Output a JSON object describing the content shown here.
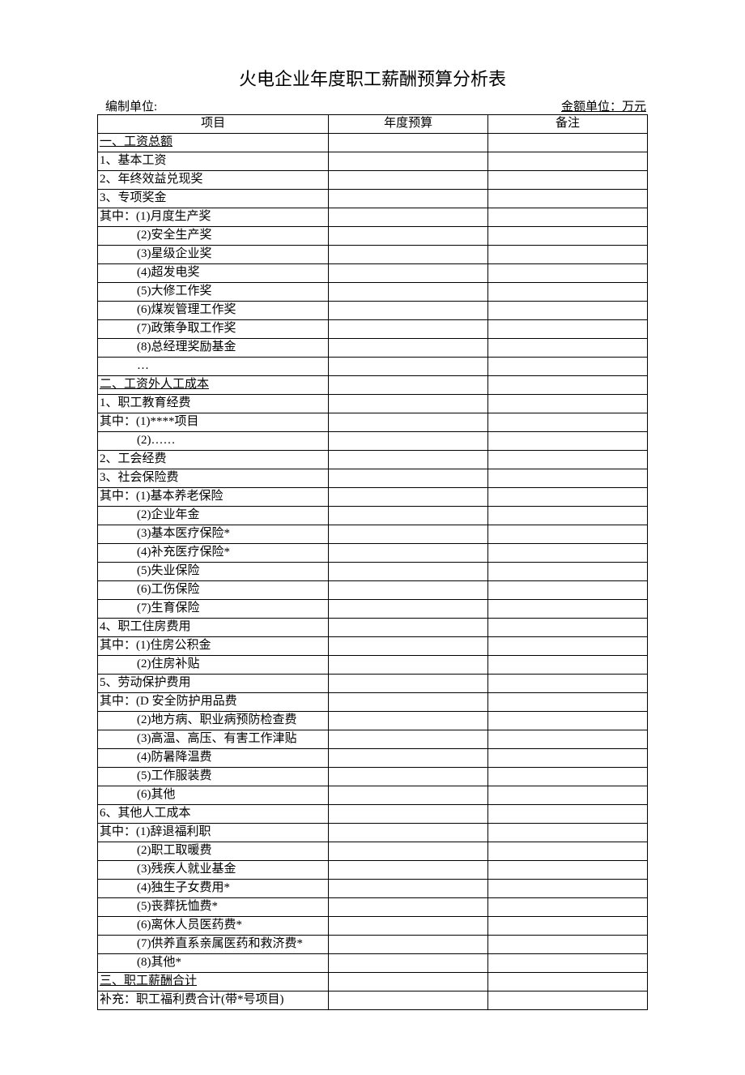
{
  "title": "火电企业年度职工薪酬预算分析表",
  "meta": {
    "left": "编制单位:",
    "right": "金额单位：万元"
  },
  "headers": {
    "c1": "项目",
    "c2": "年度预算",
    "c3": "备注"
  },
  "rows": [
    {
      "label": "一、工资总额",
      "class": "section-header"
    },
    {
      "label": "1、基本工资",
      "class": "indent0"
    },
    {
      "label": "2、年终效益兑现奖",
      "class": "indent0"
    },
    {
      "label": "3、专项奖金",
      "class": "indent0"
    },
    {
      "label": "其中：(1)月度生产奖",
      "class": "indent0"
    },
    {
      "label": "(2)安全生产奖",
      "class": "indent1"
    },
    {
      "label": "(3)星级企业奖",
      "class": "indent1"
    },
    {
      "label": "(4)超发电奖",
      "class": "indent1"
    },
    {
      "label": "(5)大修工作奖",
      "class": "indent1"
    },
    {
      "label": "(6)煤炭管理工作奖",
      "class": "indent1"
    },
    {
      "label": "(7)政策争取工作奖",
      "class": "indent1"
    },
    {
      "label": "(8)总经理奖励基金",
      "class": "indent1"
    },
    {
      "label": "…",
      "class": "centerish"
    },
    {
      "label": "二、工资外人工成本",
      "class": "section-header"
    },
    {
      "label": "1、职工教育经费",
      "class": "indent0"
    },
    {
      "label": "其中：(1)****项目",
      "class": "indent0"
    },
    {
      "label": "(2)……",
      "class": "indent1"
    },
    {
      "label": "2、工会经费",
      "class": "indent0"
    },
    {
      "label": "3、社会保险费",
      "class": "indent0"
    },
    {
      "label": "其中：(1)基本养老保险",
      "class": "indent0"
    },
    {
      "label": "(2)企业年金",
      "class": "indent1"
    },
    {
      "label": "(3)基本医疗保险*",
      "class": "indent1"
    },
    {
      "label": "(4)补充医疗保险*",
      "class": "indent1"
    },
    {
      "label": "(5)失业保险",
      "class": "indent1"
    },
    {
      "label": "(6)工伤保险",
      "class": "indent1"
    },
    {
      "label": "(7)生育保险",
      "class": "indent1"
    },
    {
      "label": "4、职工住房费用",
      "class": "indent0"
    },
    {
      "label": "其中：(1)住房公积金",
      "class": "indent0"
    },
    {
      "label": "(2)住房补贴",
      "class": "indent1"
    },
    {
      "label": "5、劳动保护费用",
      "class": "indent0"
    },
    {
      "label": "其中：(D 安全防护用品费",
      "class": "indent0"
    },
    {
      "label": "(2)地方病、职业病预防检查费",
      "class": "indent1"
    },
    {
      "label": "(3)高温、高压、有害工作津贴",
      "class": "indent1"
    },
    {
      "label": "(4)防暑降温费",
      "class": "indent1"
    },
    {
      "label": "(5)工作服装费",
      "class": "indent1"
    },
    {
      "label": "(6)其他",
      "class": "indent1"
    },
    {
      "label": "6、其他人工成本",
      "class": "indent0"
    },
    {
      "label": "其中：(1)辞退福利职",
      "class": "indent0"
    },
    {
      "label": "(2)职工取暖费",
      "class": "indent1"
    },
    {
      "label": "(3)残疾人就业基金",
      "class": "indent1"
    },
    {
      "label": "(4)独生子女费用*",
      "class": "indent1"
    },
    {
      "label": "(5)丧葬抚恤费*",
      "class": "indent1"
    },
    {
      "label": "(6)离休人员医药费*",
      "class": "indent1"
    },
    {
      "label": "(7)供养直系亲属医药和救济费*",
      "class": "indent1"
    },
    {
      "label": "(8)其他*",
      "class": "indent1"
    },
    {
      "label": "三、职工薪酬合计",
      "class": "section-header"
    },
    {
      "label": "补充：职工福利费合计(带*号项目)",
      "class": "indent0"
    }
  ]
}
